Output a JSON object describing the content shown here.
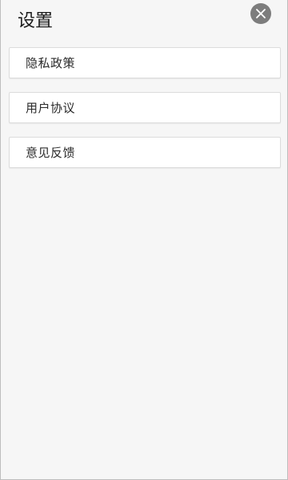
{
  "header": {
    "title": "设置",
    "close_icon": "close-icon",
    "close_color": "#7d7d7d"
  },
  "menu": {
    "items": [
      {
        "label": "隐私政策"
      },
      {
        "label": "用户协议"
      },
      {
        "label": "意见反馈"
      }
    ]
  }
}
